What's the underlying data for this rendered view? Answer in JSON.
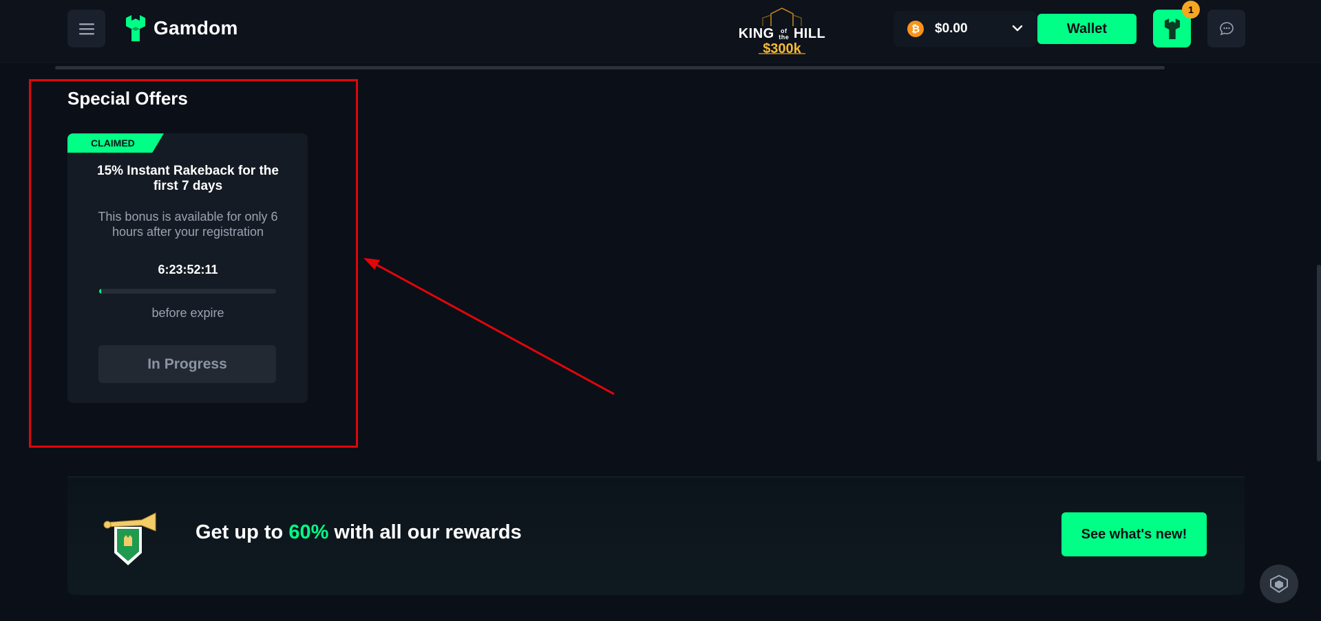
{
  "header": {
    "menu_icon": "hamburger-icon",
    "brand": "Gamdom",
    "promo": {
      "title_left": "KING",
      "title_small": "of the",
      "title_right": "HILL",
      "prize": "$300k"
    },
    "balance": {
      "currency_icon": "bitcoin-icon",
      "amount": "$0.00"
    },
    "wallet_label": "Wallet",
    "rewards_badge": "1",
    "chat_icon": "chat-icon"
  },
  "special_offers": {
    "title": "Special Offers",
    "offer": {
      "ribbon": "CLAIMED",
      "title": "15% Instant Rakeback for the first 7 days",
      "description": "This bonus is available for only 6 hours after your registration",
      "timer": "6:23:52:11",
      "progress_fraction": 0.01,
      "progress_caption": "before expire",
      "status_button": "In Progress"
    }
  },
  "promo_banner": {
    "text_prefix": "Get up to ",
    "highlight": "60%",
    "text_suffix": " with all our rewards",
    "button_label": "See what's new!"
  },
  "colors": {
    "accent": "#00ff86",
    "background": "#0b1018",
    "annotation": "#e3050a",
    "gold": "#f5b934"
  }
}
